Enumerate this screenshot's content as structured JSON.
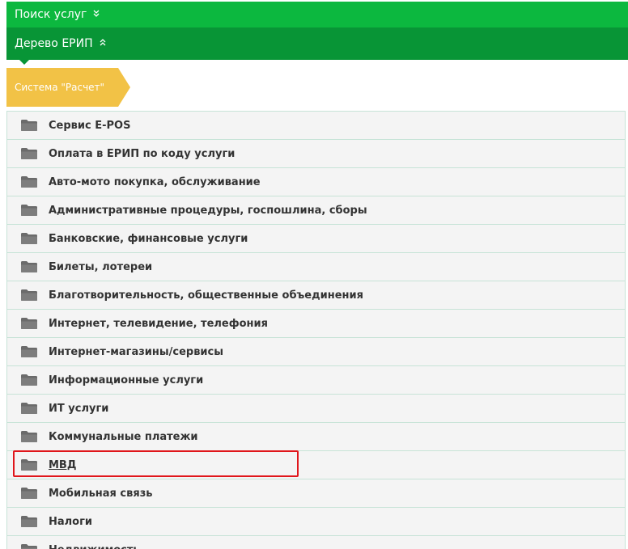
{
  "header": {
    "search_label": "Поиск услуг",
    "tree_label": "Дерево ЕРИП"
  },
  "breadcrumb": {
    "label": "Система \"Расчет\""
  },
  "categories": [
    {
      "label": "Сервис E-POS"
    },
    {
      "label": "Оплата в ЕРИП по коду услуги"
    },
    {
      "label": "Авто-мото покупка, обслуживание"
    },
    {
      "label": "Административные процедуры, госпошлина, сборы"
    },
    {
      "label": "Банковские, финансовые услуги"
    },
    {
      "label": "Билеты, лотереи"
    },
    {
      "label": "Благотворительность, общественные объединения"
    },
    {
      "label": "Интернет, телевидение, телефония"
    },
    {
      "label": "Интернет-магазины/сервисы"
    },
    {
      "label": "Информационные услуги"
    },
    {
      "label": "ИТ услуги"
    },
    {
      "label": "Коммунальные платежи"
    },
    {
      "label": "МВД",
      "selected": true
    },
    {
      "label": "Мобильная связь"
    },
    {
      "label": "Налоги"
    },
    {
      "label": "Недвижимость"
    }
  ],
  "icons": {
    "folder": "folder-icon",
    "expand": "chevron-double-down-icon",
    "collapse": "chevron-double-up-icon"
  },
  "colors": {
    "search_bar": "#0cb83f",
    "tree_bar": "#089536",
    "breadcrumb": "#f2c246",
    "highlight": "#e0161b",
    "folder": "#6b6b6b"
  }
}
